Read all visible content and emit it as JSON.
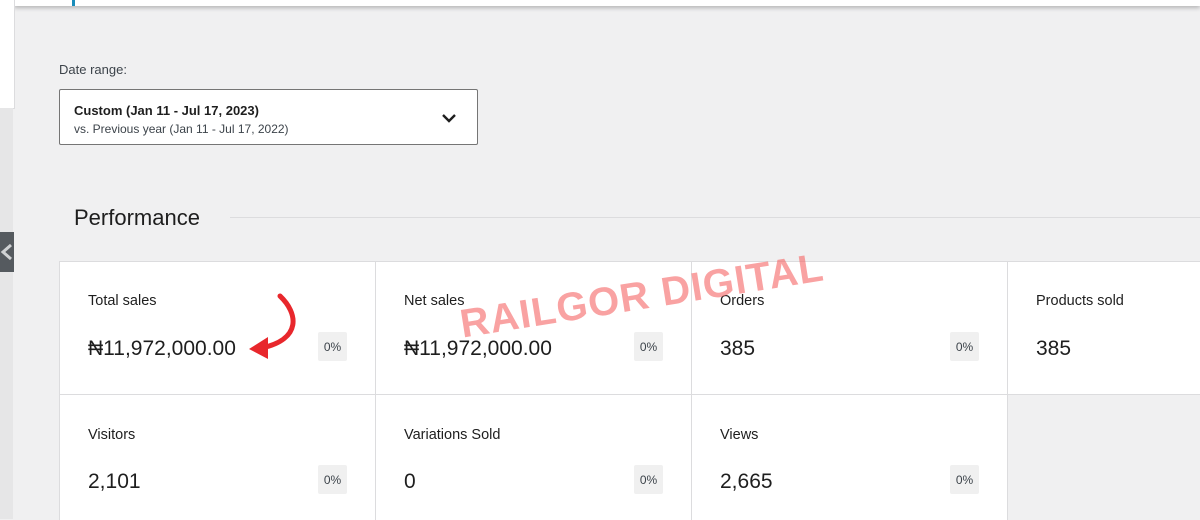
{
  "filters": {
    "date_range_label": "Date range:",
    "date_range_primary": "Custom (Jan 11 - Jul 17, 2023)",
    "date_range_secondary": "vs. Previous year (Jan 11 - Jul 17, 2022)"
  },
  "performance": {
    "title": "Performance",
    "tiles": [
      {
        "label": "Total sales",
        "value": "₦11,972,000.00",
        "change": "0%"
      },
      {
        "label": "Net sales",
        "value": "₦11,972,000.00",
        "change": "0%"
      },
      {
        "label": "Orders",
        "value": "385",
        "change": "0%"
      },
      {
        "label": "Products sold",
        "value": "385"
      },
      {
        "label": "Visitors",
        "value": "2,101",
        "change": "0%"
      },
      {
        "label": "Variations Sold",
        "value": "0",
        "change": "0%"
      },
      {
        "label": "Views",
        "value": "2,665",
        "change": "0%"
      }
    ]
  },
  "annotations": {
    "watermark": "RAILGOR DIGITAL",
    "arrow_color": "#e8272c"
  },
  "icons": {
    "dropdown": "chevron-down-icon",
    "collapse": "chevron-left-icon",
    "annotation": "curved-arrow-icon"
  }
}
